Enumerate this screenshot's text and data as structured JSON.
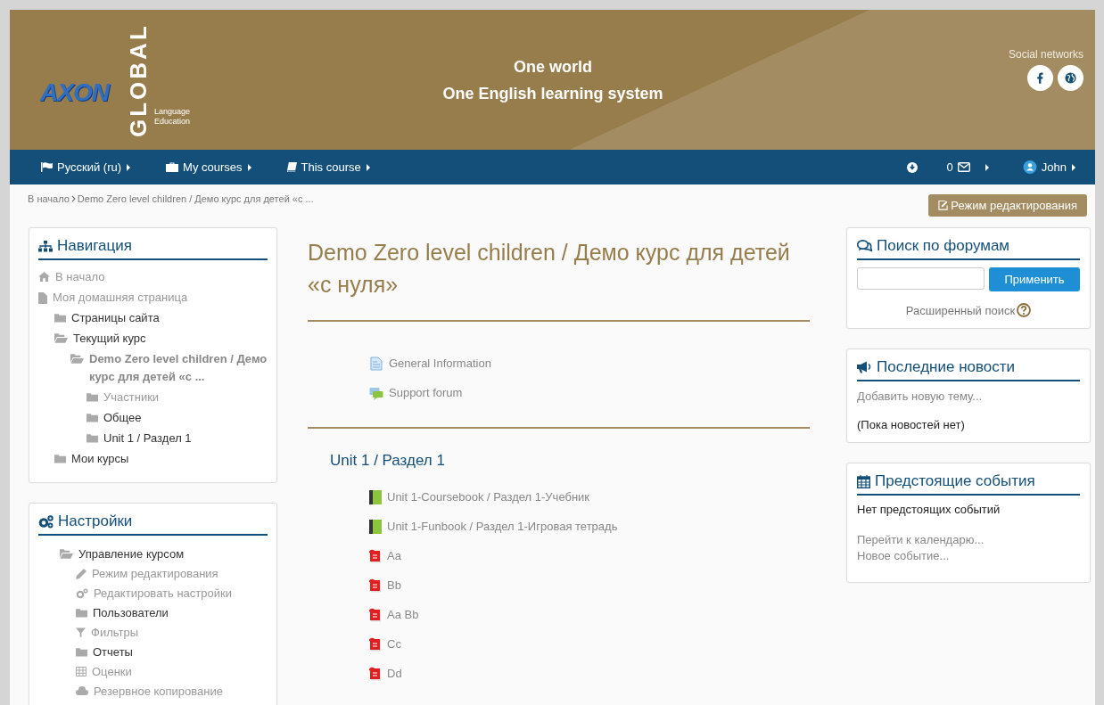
{
  "header": {
    "logo": {
      "wordmark": "AXON",
      "vertical": "GLOBAL",
      "tagline_1": "Language",
      "tagline_2": "Education"
    },
    "slogan_1": "One world",
    "slogan_2": "One English learning system",
    "social_label": "Social networks",
    "social": [
      {
        "kind": "facebook"
      },
      {
        "kind": "globe"
      }
    ]
  },
  "navbar": {
    "menus": [
      {
        "kind": "language",
        "label": "Русский (ru)"
      },
      {
        "kind": "courses",
        "label": "My courses"
      },
      {
        "kind": "course",
        "label": "This course"
      }
    ],
    "messages_count": "0",
    "user": "John"
  },
  "breadcrumb": [
    {
      "label": "В начало"
    },
    {
      "label": "Demo Zero level children / Демо курс для детей «с ..."
    }
  ],
  "edit_button": "Режим редактирования",
  "navigation": {
    "title": "Навигация",
    "items": [
      {
        "kind": "home",
        "label": "В начало",
        "muted": true,
        "active": false
      },
      {
        "kind": "page",
        "label": "Моя домашняя страница",
        "muted": true,
        "active": false,
        "children": [
          {
            "kind": "folder",
            "label": "Страницы сайта",
            "muted": false,
            "active": false
          },
          {
            "kind": "folder-open",
            "label": "Текущий курс",
            "muted": false,
            "active": false,
            "children": [
              {
                "kind": "folder-open",
                "label": "Demo Zero level children / Демо курс для детей «с ...",
                "muted": true,
                "active": true,
                "children": [
                  {
                    "kind": "folder",
                    "label": "Участники",
                    "muted": true,
                    "active": false
                  },
                  {
                    "kind": "folder",
                    "label": "Общее",
                    "muted": false,
                    "active": false
                  },
                  {
                    "kind": "folder",
                    "label": "Unit 1 / Раздел 1",
                    "muted": false,
                    "active": false
                  }
                ]
              }
            ]
          },
          {
            "kind": "folder",
            "label": "Мои курсы",
            "muted": false,
            "active": false
          }
        ]
      }
    ]
  },
  "settings": {
    "title": "Настройки",
    "items": [
      {
        "kind": "folder-open",
        "label": "Управление курсом",
        "muted": false,
        "active": false,
        "children": [
          {
            "kind": "pencil",
            "label": "Режим редактирования",
            "muted": true,
            "active": false
          },
          {
            "kind": "gears",
            "label": "Редактировать настройки",
            "muted": true,
            "active": false
          },
          {
            "kind": "folder",
            "label": "Пользователи",
            "muted": false,
            "active": false
          },
          {
            "kind": "filter",
            "label": "Фильтры",
            "muted": true,
            "active": false
          },
          {
            "kind": "folder",
            "label": "Отчеты",
            "muted": false,
            "active": false
          },
          {
            "kind": "table",
            "label": "Оценки",
            "muted": true,
            "active": false
          },
          {
            "kind": "cloud",
            "label": "Резервное копирование",
            "muted": true,
            "active": false
          }
        ]
      }
    ]
  },
  "course": {
    "title": "Demo Zero level children / Демо курс для детей «с нуля»",
    "general": [
      {
        "kind": "page",
        "label": "General Information"
      },
      {
        "kind": "forum",
        "label": "Support forum"
      }
    ],
    "sections": [
      {
        "title": "Unit 1 / Раздел 1",
        "activities": [
          {
            "kind": "book",
            "label": "Unit 1-Coursebook / Раздел 1-Учебник"
          },
          {
            "kind": "book",
            "label": "Unit 1-Funbook / Раздел 1-Игровая тетрадь"
          },
          {
            "kind": "pdf",
            "label": "Aa"
          },
          {
            "kind": "pdf",
            "label": "Bb"
          },
          {
            "kind": "pdf",
            "label": "Aa Bb"
          },
          {
            "kind": "pdf",
            "label": "Cc"
          },
          {
            "kind": "pdf",
            "label": "Dd"
          }
        ]
      }
    ]
  },
  "forum_search": {
    "title": "Поиск по форумам",
    "button": "Применить",
    "advanced": "Расширенный поиск"
  },
  "news": {
    "title": "Последние новости",
    "add_link": "Добавить новую тему...",
    "empty": "(Пока новостей нет)"
  },
  "events": {
    "title": "Предстоящие события",
    "empty": "Нет предстоящих событий",
    "links": [
      "Перейти к календарю...",
      "Новое событие..."
    ]
  }
}
